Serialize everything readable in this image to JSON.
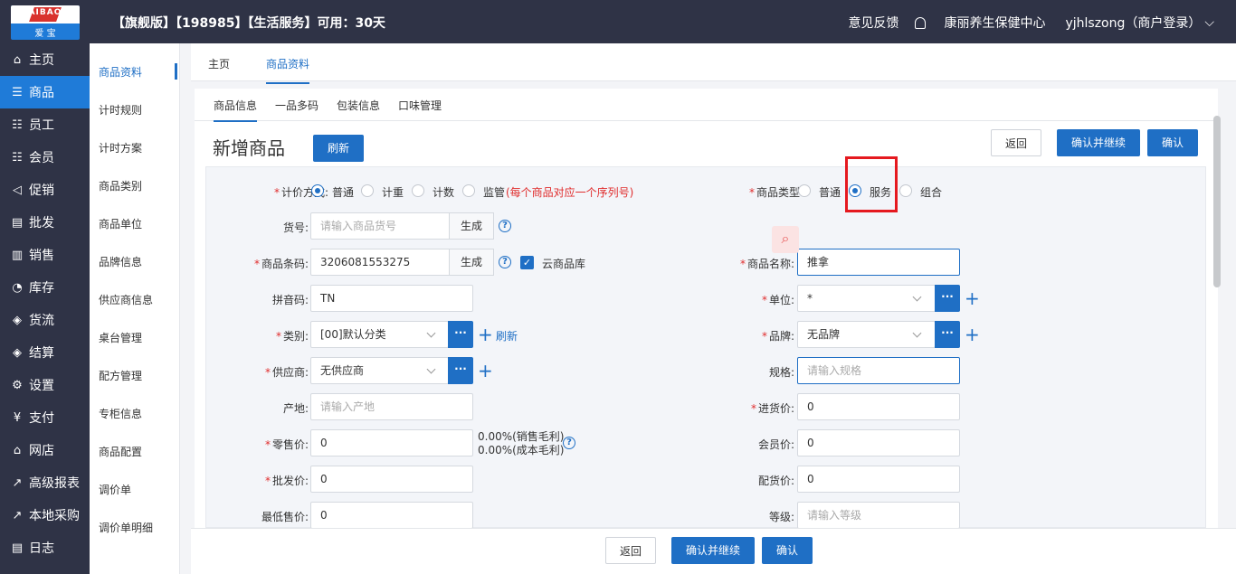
{
  "topbar": {
    "logo_text": "AIBAO",
    "logo_sub": "爱 宝",
    "title": "【旗舰版】【198985】【生活服务】可用：30天",
    "feedback": "意见反馈",
    "store": "康丽养生保健中心",
    "user": "yjhlszong（商户登录）"
  },
  "leftnav": {
    "items": [
      {
        "icon": "⌂",
        "label": "主页"
      },
      {
        "icon": "☰",
        "label": "商品"
      },
      {
        "icon": "☷",
        "label": "员工"
      },
      {
        "icon": "☷",
        "label": "会员"
      },
      {
        "icon": "◁",
        "label": "促销"
      },
      {
        "icon": "▤",
        "label": "批发"
      },
      {
        "icon": "▥",
        "label": "销售"
      },
      {
        "icon": "◔",
        "label": "库存"
      },
      {
        "icon": "◈",
        "label": "货流"
      },
      {
        "icon": "◈",
        "label": "结算"
      },
      {
        "icon": "⚙",
        "label": "设置"
      },
      {
        "icon": "¥",
        "label": "支付"
      },
      {
        "icon": "⌂",
        "label": "网店"
      },
      {
        "icon": "↗",
        "label": "高级报表"
      },
      {
        "icon": "↗",
        "label": "本地采购"
      },
      {
        "icon": "▤",
        "label": "日志"
      }
    ]
  },
  "subnav": {
    "items": [
      "商品资料",
      "计时规则",
      "计时方案",
      "商品类别",
      "商品单位",
      "品牌信息",
      "供应商信息",
      "桌台管理",
      "配方管理",
      "专柜信息",
      "商品配置",
      "调价单",
      "调价单明细"
    ]
  },
  "page_tabs": [
    "主页",
    "商品资料"
  ],
  "form_tabs": [
    "商品信息",
    "一品多码",
    "包装信息",
    "口味管理"
  ],
  "page_title": "新增商品",
  "buttons": {
    "refresh": "刷新",
    "back": "返回",
    "confirm_continue": "确认并继续",
    "confirm": "确认",
    "generate": "生成",
    "dots": "···"
  },
  "form": {
    "pricing_label": "计价方式:",
    "pricing_options": [
      "普通",
      "计重",
      "计数",
      "监管"
    ],
    "pricing_note": "(每个商品对应一个序列号)",
    "type_label": "商品类型:",
    "type_options": [
      "普通",
      "服务",
      "组合"
    ],
    "sku_label": "货号:",
    "sku_placeholder": "请输入商品货号",
    "barcode_label": "商品条码:",
    "barcode_value": "3206081553275",
    "cloud_label": "云商品库",
    "name_label": "商品名称:",
    "name_value": "推拿",
    "pinyin_label": "拼音码:",
    "pinyin_value": "TN",
    "unit_label": "单位:",
    "unit_value": "*",
    "category_label": "类别:",
    "category_value": "[00]默认分类",
    "category_refresh": "刷新",
    "brand_label": "品牌:",
    "brand_value": "无品牌",
    "supplier_label": "供应商:",
    "supplier_value": "无供应商",
    "spec_label": "规格:",
    "spec_placeholder": "请输入规格",
    "origin_label": "产地:",
    "origin_placeholder": "请输入产地",
    "purchase_label": "进货价:",
    "purchase_value": "0",
    "retail_label": "零售价:",
    "retail_value": "0",
    "margin_sale": "0.00%(销售毛利)",
    "margin_cost": "0.00%(成本毛利)",
    "member_label": "会员价:",
    "member_value": "0",
    "wholesale_label": "批发价:",
    "wholesale_value": "0",
    "distribution_label": "配货价:",
    "distribution_value": "0",
    "min_price_label": "最低售价:",
    "min_price_value": "0",
    "grade_label": "等级:",
    "grade_placeholder": "请输入等级"
  },
  "colors": {
    "primary": "#1f6fc5",
    "nav_bg": "#2f3346",
    "active_nav": "#1f7bd8",
    "required": "#e02d2d",
    "highlight": "#e5191f"
  }
}
